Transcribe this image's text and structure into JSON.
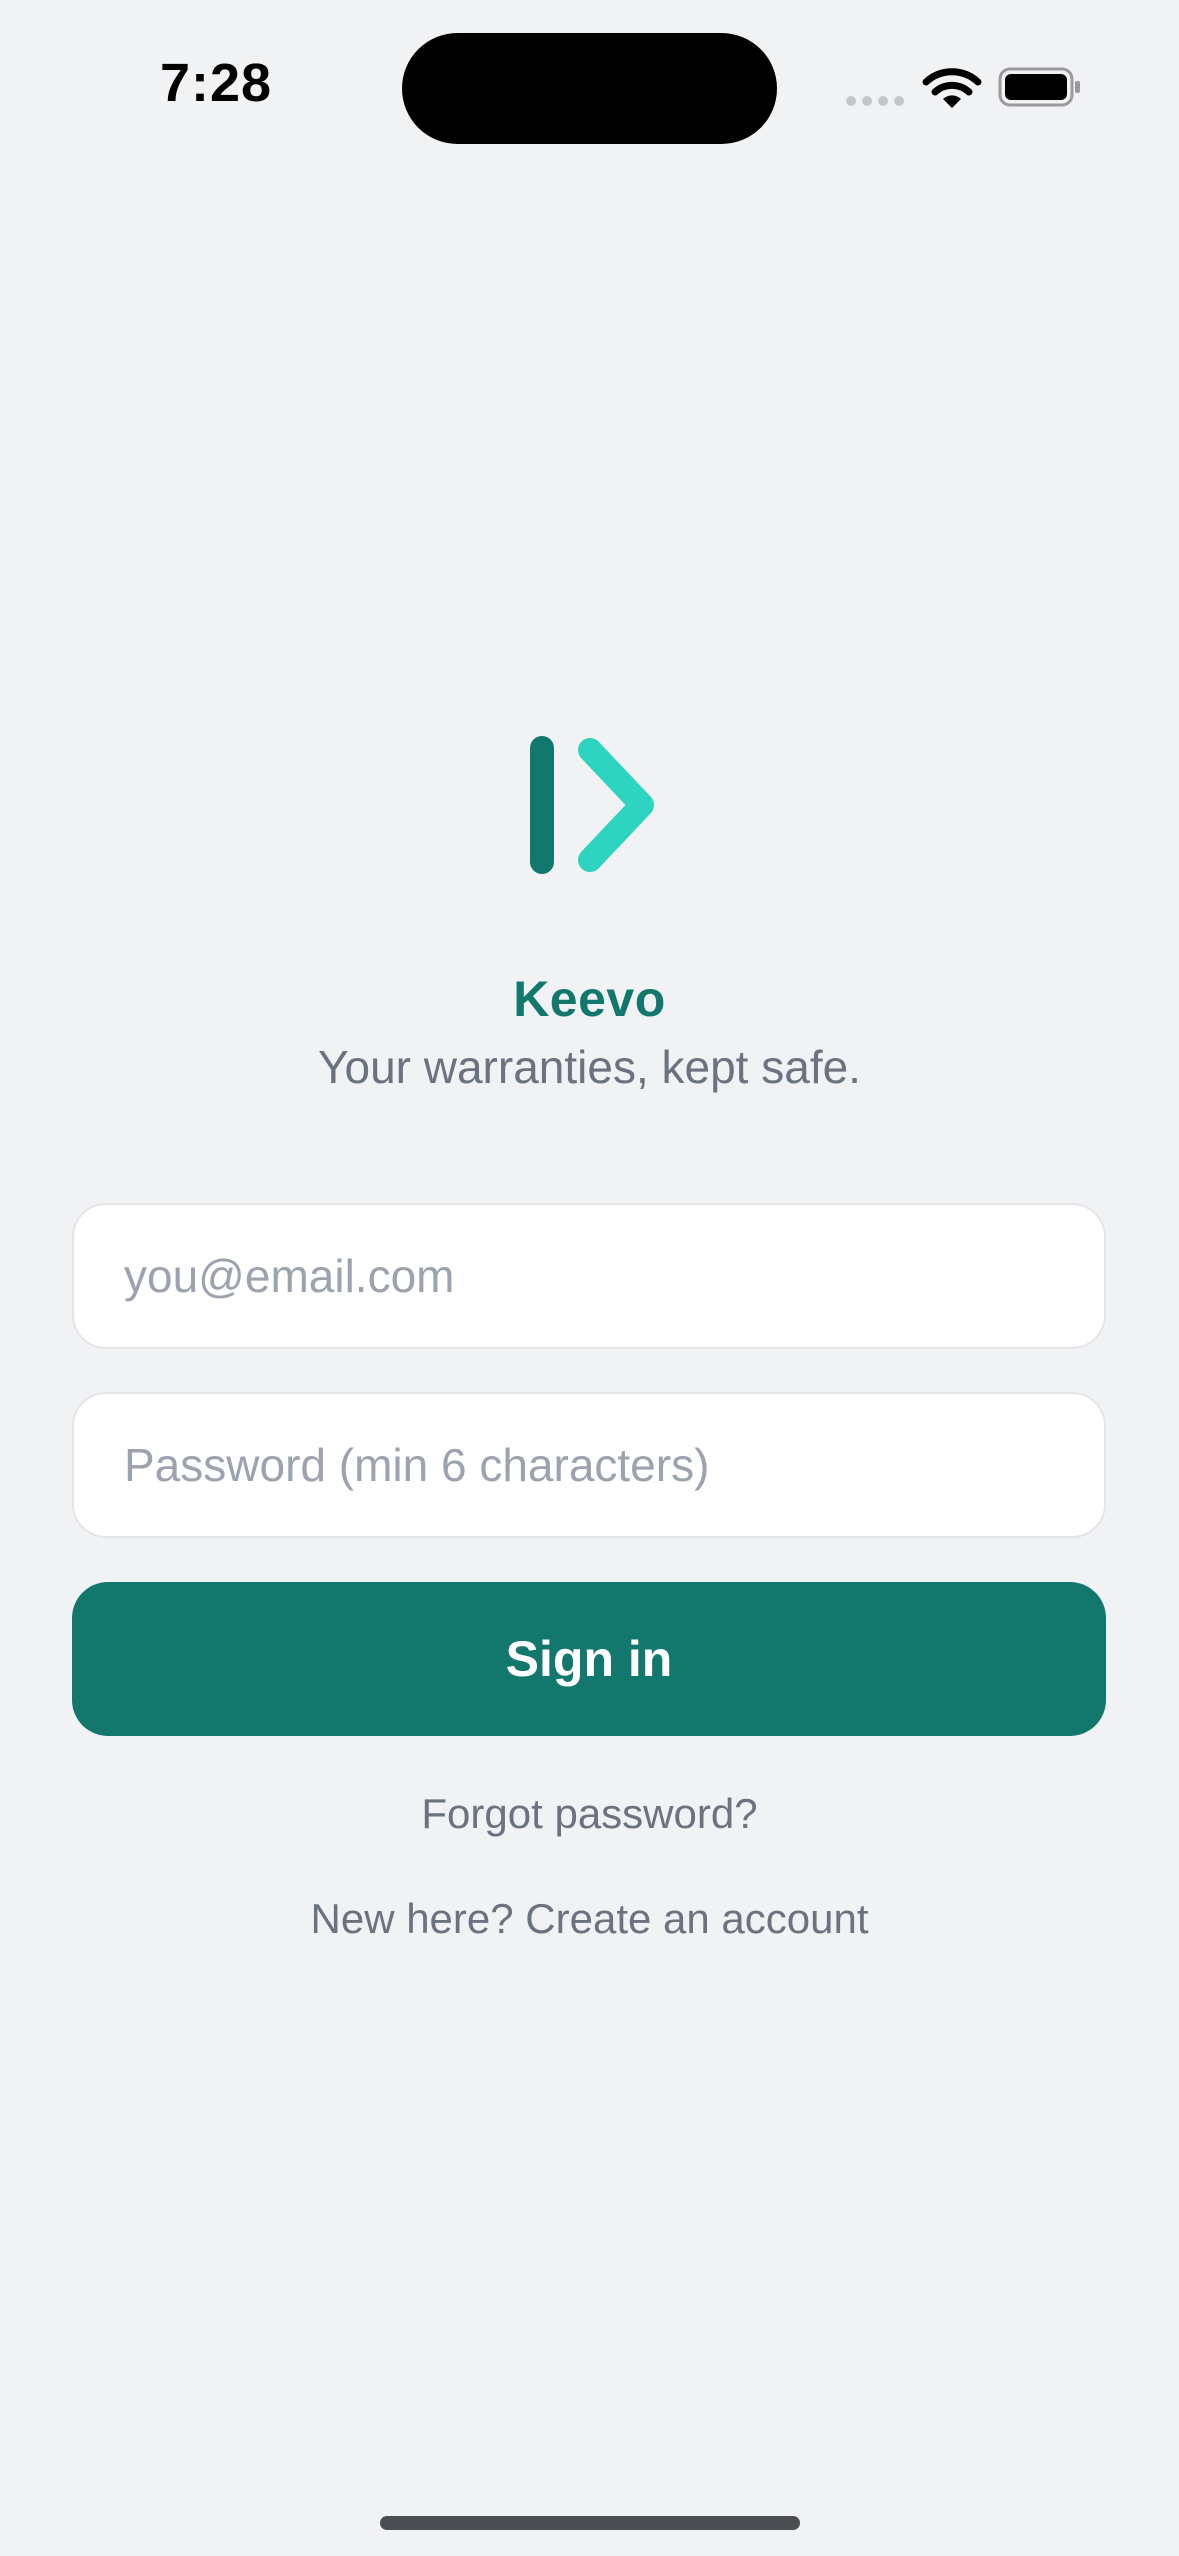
{
  "status_bar": {
    "time": "7:28",
    "icons": [
      "cellular-signal-icon",
      "wifi-icon",
      "battery-icon"
    ]
  },
  "brand": {
    "name": "Keevo",
    "tagline": "Your warranties, kept safe.",
    "logo_icon": "keevo-logo-icon",
    "colors": {
      "primary": "#12776D",
      "accent": "#2DD4BF"
    }
  },
  "form": {
    "email": {
      "value": "",
      "placeholder": "you@email.com"
    },
    "password": {
      "value": "",
      "placeholder": "Password (min 6 characters)"
    },
    "submit_label": "Sign in"
  },
  "links": {
    "forgot_password": "Forgot password?",
    "create_account": "New here? Create an account"
  },
  "theme": {
    "background": "#F1F2F4",
    "muted_text": "#6B7280",
    "field_border": "#E3E5E8"
  }
}
